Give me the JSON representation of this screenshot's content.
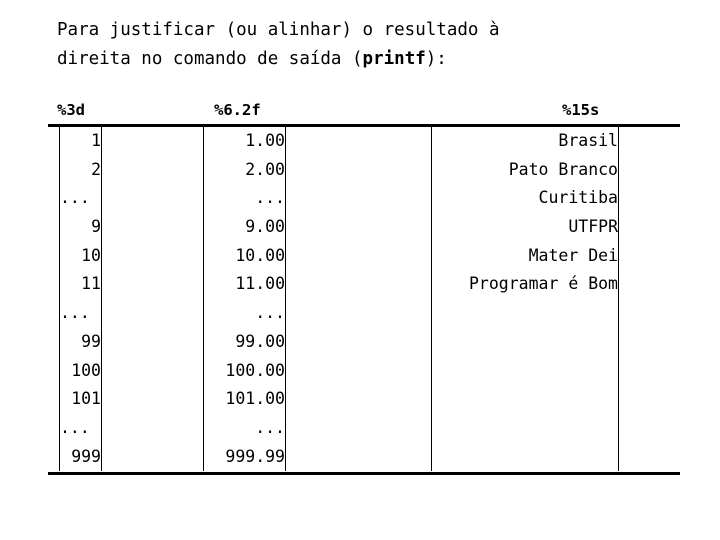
{
  "slide": {
    "intro_line1": "Para justificar (ou alinhar) o resultado à",
    "intro_line2_before": "direita no comando de saída (",
    "intro_code": "printf",
    "intro_line2_after": "):"
  },
  "table": {
    "headers": [
      "%3d",
      "%6.2f",
      "%15s"
    ],
    "rows": [
      {
        "d": "1",
        "f": "1.00",
        "s": "Brasil"
      },
      {
        "d": "2",
        "f": "2.00",
        "s": "Pato Branco"
      },
      {
        "d": "...",
        "f": "...",
        "s": "Curitiba"
      },
      {
        "d": "9",
        "f": "9.00",
        "s": "UTFPR"
      },
      {
        "d": "10",
        "f": "10.00",
        "s": "Mater Dei"
      },
      {
        "d": "11",
        "f": "11.00",
        "s": "Programar é Bom"
      },
      {
        "d": "...",
        "f": "...",
        "s": ""
      },
      {
        "d": "99",
        "f": "99.00",
        "s": ""
      },
      {
        "d": "100",
        "f": "100.00",
        "s": ""
      },
      {
        "d": "101",
        "f": "101.00",
        "s": ""
      },
      {
        "d": "...",
        "f": "...",
        "s": ""
      },
      {
        "d": "999",
        "f": "999.99",
        "s": ""
      }
    ]
  },
  "colors": {
    "background": "#ffffff",
    "text": "#000000",
    "rule": "#000000"
  }
}
